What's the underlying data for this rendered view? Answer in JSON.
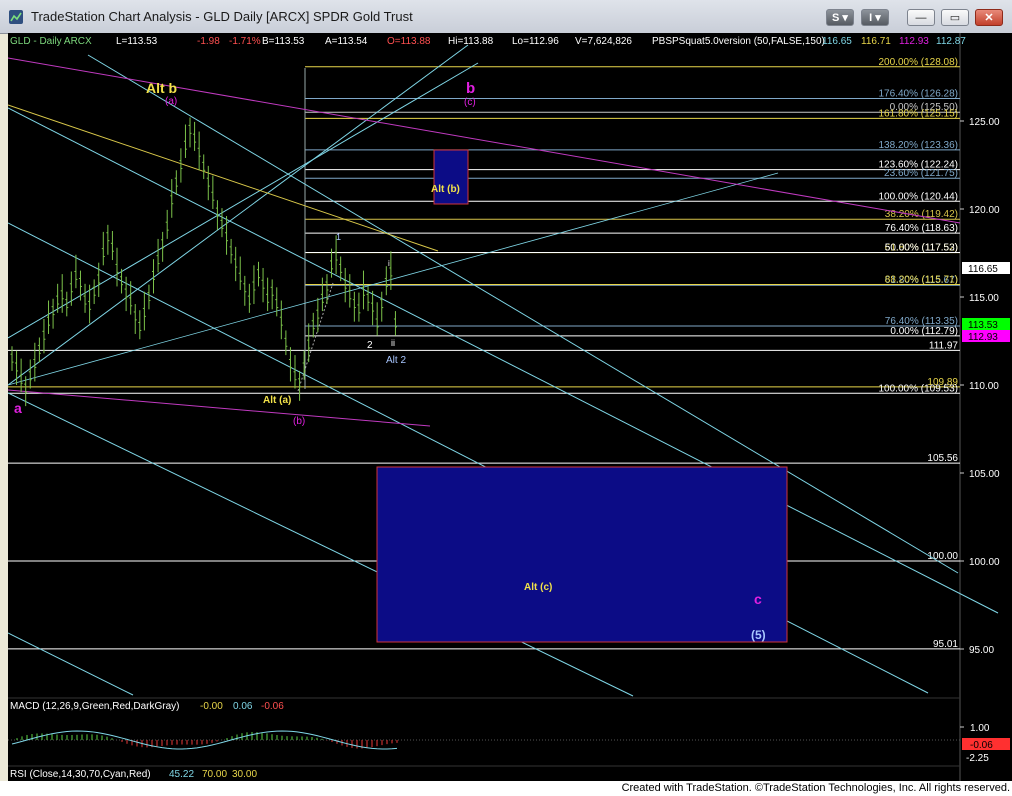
{
  "window": {
    "title": "TradeStation Chart Analysis - GLD Daily [ARCX] SPDR Gold Trust",
    "buttons": {
      "s": "S",
      "i": "I",
      "minimize": "—",
      "maximize": "▭",
      "close": "✕"
    }
  },
  "header": {
    "symbol": "GLD - Daily",
    "exchange": "ARCX",
    "last": "L=113.53",
    "change": "-1.98",
    "pct_change": "-1.71%",
    "bid": "B=113.53",
    "ask": "A=113.54",
    "open": "O=113.88",
    "high": "Hi=113.88",
    "low": "Lo=112.96",
    "volume": "V=7,624,826",
    "indicator": "PBSPSquat5.0version (50,FALSE,150)",
    "indicator_values": [
      "116.65",
      "116.71",
      "112.93",
      "112.87"
    ]
  },
  "fib_levels": [
    {
      "label": "200.00% (128.08)",
      "price": 128.08,
      "color": "#e8d64a"
    },
    {
      "label": "176.40% (126.28)",
      "price": 126.28,
      "color": "#7fa8c9"
    },
    {
      "label": "0.00% (125.50)",
      "price": 125.5,
      "color": "#c8c8c8"
    },
    {
      "label": "161.80% (125.15)",
      "price": 125.15,
      "color": "#e8d64a"
    },
    {
      "label": "138.20% (123.36)",
      "price": 123.36,
      "color": "#7fa8c9"
    },
    {
      "label": "123.60% (122.24)",
      "price": 122.24,
      "color": "#ffffff"
    },
    {
      "label": "23.60% (121.75)",
      "price": 121.75,
      "color": "#7fa8c9"
    },
    {
      "label": "100.00% (120.44)",
      "price": 120.44,
      "color": "#ffffff"
    },
    {
      "label": "38.20% (119.42)",
      "price": 119.42,
      "color": "#d7c34a"
    },
    {
      "label": "76.40% (118.63)",
      "price": 118.63,
      "color": "#ffffff"
    },
    {
      "label": "61.80% (117.52)",
      "price": 117.52,
      "color": "#e8d64a"
    },
    {
      "label": "50.00% (117.53)",
      "price": 117.53,
      "color": "#ffffff"
    },
    {
      "label": "61.80% (115.67)",
      "price": 115.67,
      "color": "#7fa8c9"
    },
    {
      "label": "88.20% (115.71)",
      "price": 115.71,
      "color": "#e8d64a"
    },
    {
      "label": "76.40% (113.35)",
      "price": 113.35,
      "color": "#7fa8c9"
    },
    {
      "label": "0.00% (112.79)",
      "price": 112.79,
      "color": "#ffffff"
    },
    {
      "label": "111.97",
      "price": 111.97,
      "color": "#ffffff"
    },
    {
      "label": "109.89",
      "price": 109.89,
      "color": "#e8d64a"
    },
    {
      "label": "100.00% (109.53)",
      "price": 109.53,
      "color": "#ffffff"
    },
    {
      "label": "105.56",
      "price": 105.56,
      "color": "#ffffff"
    },
    {
      "label": "100.00",
      "price": 100.0,
      "color": "#ffffff"
    },
    {
      "label": "95.01",
      "price": 95.01,
      "color": "#ffffff"
    }
  ],
  "price_axis": {
    "ticks": [
      "125.00",
      "120.00",
      "115.00",
      "110.00",
      "105.00",
      "100.00",
      "95.00"
    ],
    "last_price_tags": [
      {
        "text": "116.65",
        "bg": "#ffffff",
        "fg": "#000000"
      },
      {
        "text": "113.53",
        "bg": "#00ff00",
        "fg": "#000000"
      },
      {
        "text": "112.93",
        "bg": "#ff00ff",
        "fg": "#000000"
      }
    ]
  },
  "wave_labels": {
    "alt_b": "Alt b",
    "alt_b_sub": "(a)",
    "b": "b",
    "b_sub": "(c)",
    "alt_paren_b": "Alt (b)",
    "alt_paren_a": "Alt (a)",
    "paren_b": "(b)",
    "a": "a",
    "one": "1",
    "two": "2",
    "ii": "ii",
    "i": "i",
    "alt_2": "Alt 2",
    "alt_c": "Alt (c)",
    "c": "c",
    "five": "(5)"
  },
  "macd": {
    "label": "MACD (12,26,9,Green,Red,DarkGray)",
    "v1": "-0.00",
    "v2": "0.06",
    "v3": "-0.06",
    "axis_ticks": [
      "1.00",
      "-2.25"
    ],
    "tag": "-0.06"
  },
  "rsi": {
    "label": "RSI (Close,14,30,70,Cyan,Red)",
    "v1": "45.22",
    "v2": "70.00",
    "v3": "30.00"
  },
  "footer": {
    "text": "Created with TradeStation. ©TradeStation Technologies, Inc. All rights reserved."
  },
  "colors": {
    "background": "#000000",
    "candle": "#7cc24a",
    "trendline_cyan": "#7fd6e6",
    "trendline_magenta": "#c03ac0",
    "trendline_yellow": "#d9c84a",
    "box_fill": "#0c0c86",
    "box_border": "#d0343a",
    "alt_label": "#f2e24a",
    "wave_magenta": "#e020e0",
    "wave_blue": "#a8c6ff"
  }
}
